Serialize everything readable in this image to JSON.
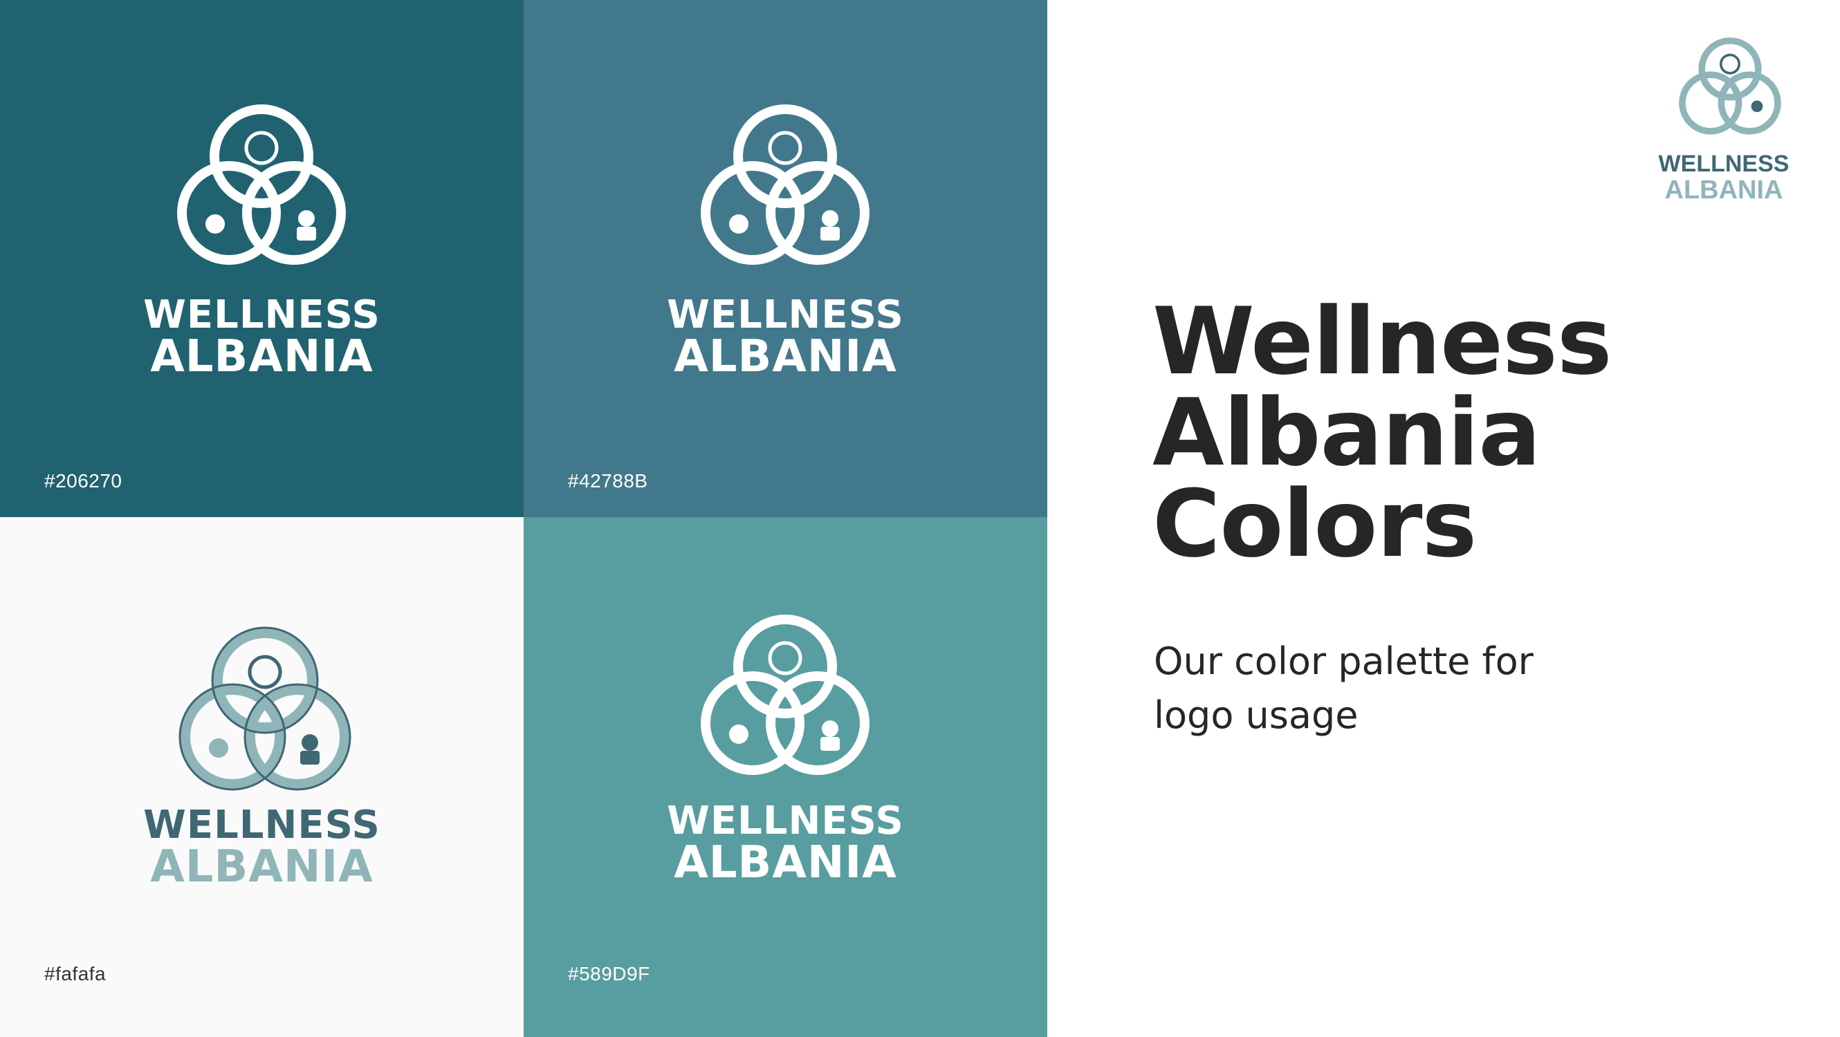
{
  "heading": {
    "line1": "Wellness",
    "line2": "Albania",
    "line3": "Colors"
  },
  "subtitle": "Our color palette for logo usage",
  "logo_wordmark": {
    "line1": "WELLNESS",
    "line2": "ALBANIA"
  },
  "swatches": [
    {
      "hex_label": "#206270",
      "background": "#206270",
      "logo_variant": "white"
    },
    {
      "hex_label": "#42788B",
      "background": "#42788B",
      "logo_variant": "white"
    },
    {
      "hex_label": "#fafafa",
      "background": "#fafafa",
      "logo_variant": "color"
    },
    {
      "hex_label": "#589D9F",
      "background": "#589D9F",
      "logo_variant": "white"
    }
  ],
  "colors": {
    "text_dark": "#262626",
    "logo_dark": "#3f6774",
    "logo_light": "#8fb5b9"
  }
}
